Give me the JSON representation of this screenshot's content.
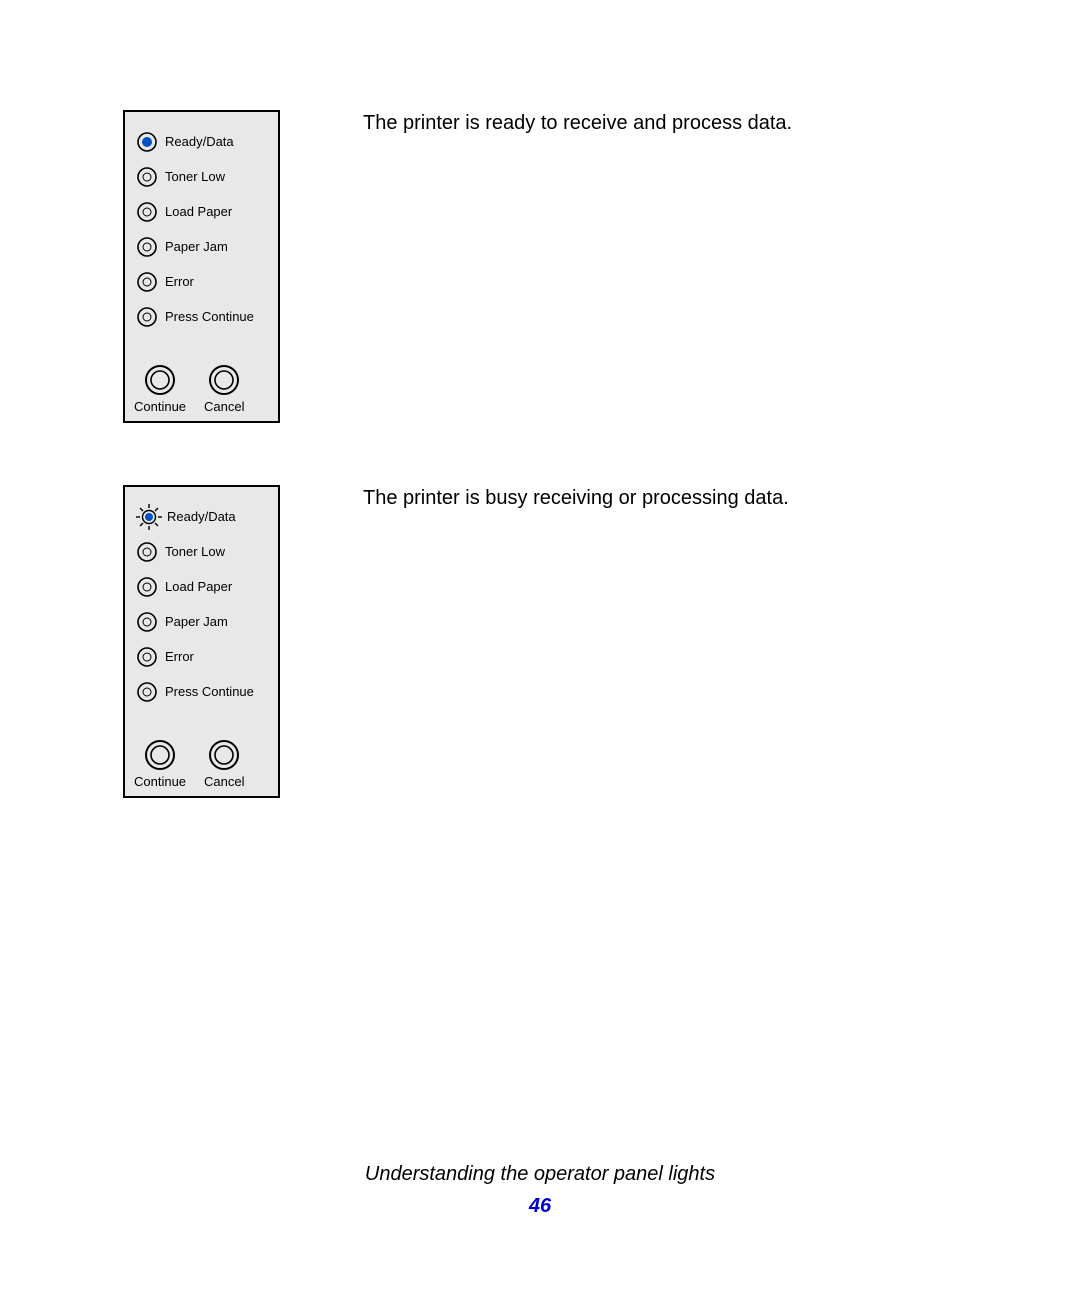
{
  "descriptions": {
    "ready": "The printer is ready to receive and process data.",
    "busy": "The printer is busy receiving or processing data."
  },
  "panel": {
    "lights": {
      "ready_data": "Ready/Data",
      "toner_low": "Toner Low",
      "load_paper": "Load Paper",
      "paper_jam": "Paper Jam",
      "error": "Error",
      "press_continue": "Press Continue"
    },
    "buttons": {
      "continue": "Continue",
      "cancel": "Cancel"
    }
  },
  "footer": {
    "section_title": "Understanding the operator panel lights",
    "page_number": "46"
  }
}
